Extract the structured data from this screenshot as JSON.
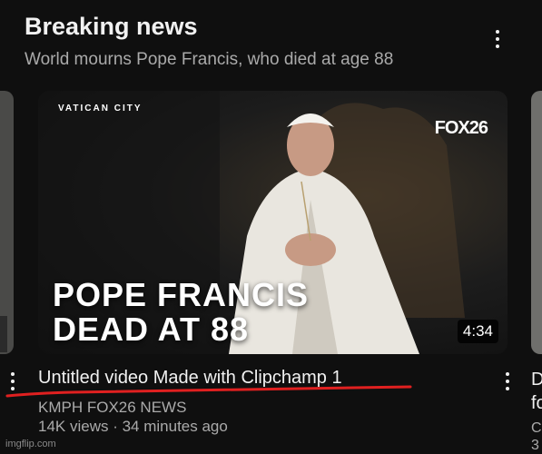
{
  "section": {
    "title": "Breaking news",
    "subtitle": "World mourns Pope Francis, who died at age 88"
  },
  "video": {
    "thumbnail_overlay_location": "VATICAN CITY",
    "thumbnail_overlay_logo": "FOX26",
    "thumbnail_headline_line1": "POPE FRANCIS",
    "thumbnail_headline_line2": "DEAD AT 88",
    "duration": "4:34",
    "title": "Untitled video   Made with Clipchamp 1",
    "channel": "KMPH FOX26 NEWS",
    "meta": "14K views · 34 minutes ago"
  },
  "next_video": {
    "title_partial": "D\nfo",
    "meta_partial": "C\n3"
  },
  "watermark": "imgflip.com",
  "colors": {
    "background": "#0f0f0f",
    "text_primary": "#f1f1f1",
    "text_secondary": "#aaaaaa",
    "underline": "#e02020"
  },
  "icons": [
    "more-vert-icon"
  ]
}
